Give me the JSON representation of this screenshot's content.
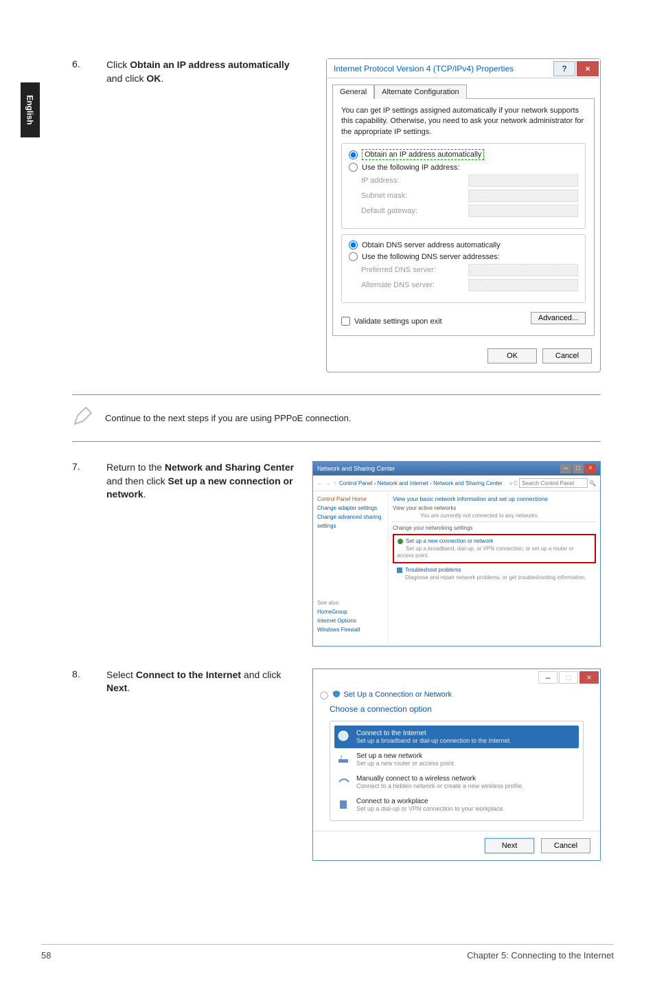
{
  "sidebar_label": "English",
  "steps": {
    "s6": {
      "num": "6.",
      "text_pre": "Click ",
      "bold1": "Obtain an IP address automatically",
      "mid": " and click ",
      "bold2": "OK",
      "post": "."
    },
    "s7": {
      "num": "7.",
      "text_pre": "Return to the ",
      "bold1": "Network and Sharing Center",
      "mid": " and then click ",
      "bold2": "Set up a new connection or network",
      "post": "."
    },
    "s8": {
      "num": "8.",
      "text_pre": "Select ",
      "bold1": "Connect to the Internet",
      "mid": " and click ",
      "bold2": "Next",
      "post": "."
    }
  },
  "note_text": "Continue to the next steps if you are using PPPoE connection.",
  "ipv4_dialog": {
    "title": "Internet Protocol Version 4 (TCP/IPv4) Properties",
    "tab_general": "General",
    "tab_alt": "Alternate Configuration",
    "desc": "You can get IP settings assigned automatically if your network supports this capability. Otherwise, you need to ask your network administrator for the appropriate IP settings.",
    "opt_auto_ip": "Obtain an IP address automatically",
    "opt_use_ip": "Use the following IP address:",
    "ip_address": "IP address:",
    "subnet": "Subnet mask:",
    "gateway": "Default gateway:",
    "opt_auto_dns": "Obtain DNS server address automatically",
    "opt_use_dns": "Use the following DNS server addresses:",
    "pref_dns": "Preferred DNS server:",
    "alt_dns": "Alternate DNS server:",
    "validate": "Validate settings upon exit",
    "advanced": "Advanced...",
    "ok": "OK",
    "cancel": "Cancel"
  },
  "nsc_window": {
    "title": "Network and Sharing Center",
    "breadcrumb": "Control Panel  ›  Network and Internet  ›  Network and Sharing Center",
    "search_ph": "Search Control Panel",
    "side": {
      "home": "Control Panel Home",
      "adapter": "Change adapter settings",
      "sharing": "Change advanced sharing settings",
      "see_also": "See also",
      "homegroup": "HomeGroup",
      "inet": "Internet Options",
      "firewall": "Windows Firewall"
    },
    "main": {
      "h1": "View your basic network information and set up connections",
      "h2": "View your active networks",
      "no_net": "You are currently not connected to any networks.",
      "h3": "Change your networking settings",
      "opt1_t": "Set up a new connection or network",
      "opt1_d": "Set up a broadband, dial-up, or VPN connection; or set up a router or access point.",
      "opt2_t": "Troubleshoot problems",
      "opt2_d": "Diagnose and repair network problems, or get troubleshooting information."
    }
  },
  "wizard": {
    "sub": "Set Up a Connection or Network",
    "heading": "Choose a connection option",
    "opts": [
      {
        "t": "Connect to the Internet",
        "d": "Set up a broadband or dial-up connection to the Internet."
      },
      {
        "t": "Set up a new network",
        "d": "Set up a new router or access point."
      },
      {
        "t": "Manually connect to a wireless network",
        "d": "Connect to a hidden network or create a new wireless profile."
      },
      {
        "t": "Connect to a workplace",
        "d": "Set up a dial-up or VPN connection to your workplace."
      }
    ],
    "next": "Next",
    "cancel": "Cancel"
  },
  "footer": {
    "page": "58",
    "chapter": "Chapter 5: Connecting to the Internet"
  }
}
